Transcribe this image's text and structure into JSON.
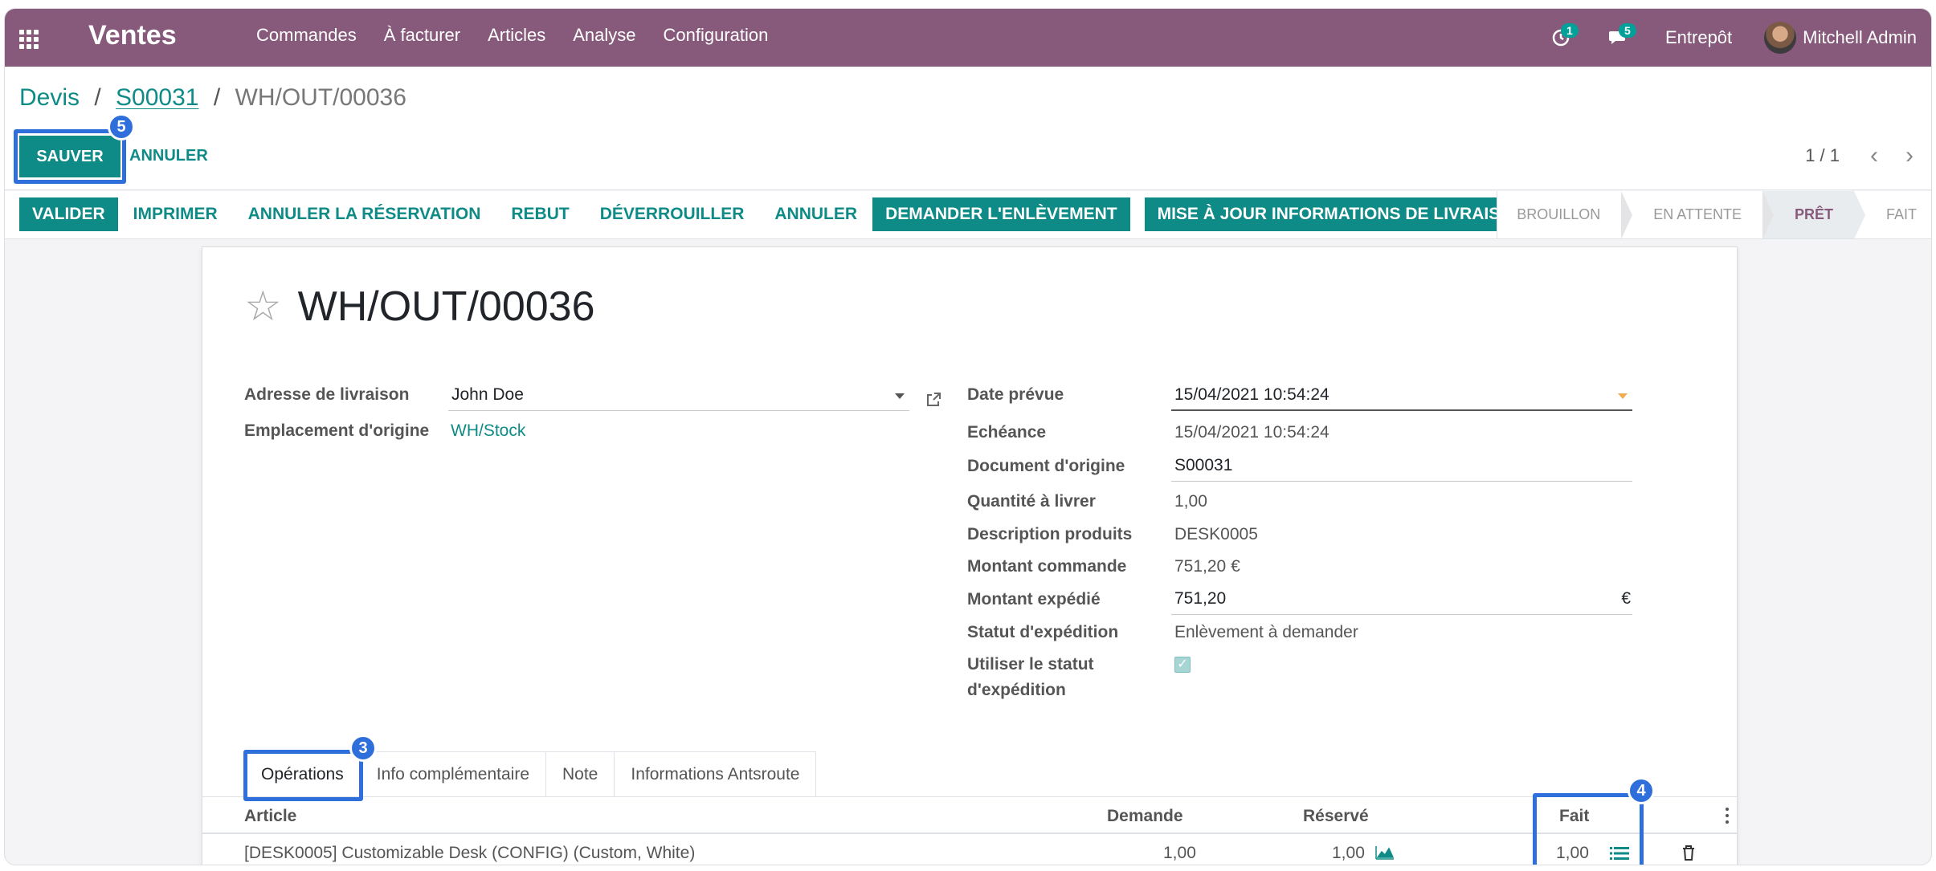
{
  "navbar": {
    "app_title": "Ventes",
    "menu": [
      "Commandes",
      "À facturer",
      "Articles",
      "Analyse",
      "Configuration"
    ],
    "activity_count": "1",
    "messages_count": "5",
    "company": "Entrepôt",
    "user": "Mitchell Admin",
    "accent": "#875a7b"
  },
  "breadcrumb": {
    "items": [
      "Devis",
      "S00031"
    ],
    "current": "WH/OUT/00036",
    "sep": "/"
  },
  "actions": {
    "save": "SAUVER",
    "discard": "ANNULER"
  },
  "pager": {
    "value": "1 / 1",
    "prev": "‹",
    "next": "›"
  },
  "statusbar": {
    "buttons": [
      "VALIDER",
      "IMPRIMER",
      "ANNULER LA RÉSERVATION",
      "REBUT",
      "DÉVERROUILLER",
      "ANNULER",
      "DEMANDER L'ENLÈVEMENT",
      "MISE À JOUR INFORMATIONS DE LIVRAISON"
    ],
    "stages": [
      "BROUILLON",
      "EN ATTENTE",
      "PRÊT",
      "FAIT"
    ],
    "active_stage": "PRÊT"
  },
  "form": {
    "record_name": "WH/OUT/00036",
    "left": {
      "delivery_address_label": "Adresse de livraison",
      "delivery_address_value": "John Doe",
      "source_location_label": "Emplacement d'origine",
      "source_location_value": "WH/Stock"
    },
    "right": {
      "scheduled_date_label": "Date prévue",
      "scheduled_date_value": "15/04/2021 10:54:24",
      "deadline_label": "Echéance",
      "deadline_value": "15/04/2021 10:54:24",
      "origin_label": "Document d'origine",
      "origin_value": "S00031",
      "qty_label": "Quantité à livrer",
      "qty_value": "1,00",
      "product_desc_label": "Description produits",
      "product_desc_value": "DESK0005",
      "order_amount_label": "Montant commande",
      "order_amount_value": "751,20 €",
      "shipped_amount_label": "Montant expédié",
      "shipped_amount_value": "751,20",
      "shipped_amount_currency": "€",
      "shipping_status_label": "Statut d'expédition",
      "shipping_status_value": "Enlèvement à demander",
      "use_status_label_1": "Utiliser le statut",
      "use_status_label_2": "d'expédition",
      "use_status_checked": true
    }
  },
  "tabs": [
    "Opérations",
    "Info complémentaire",
    "Note",
    "Informations Antsroute"
  ],
  "table": {
    "headers": {
      "article": "Article",
      "demand": "Demande",
      "reserved": "Réservé",
      "done": "Fait"
    },
    "rows": [
      {
        "article": "[DESK0005] Customizable Desk (CONFIG) (Custom, White)",
        "demand": "1,00",
        "reserved": "1,00",
        "done": "1,00"
      }
    ]
  },
  "markers": {
    "save": "5",
    "tab": "3",
    "done": "4"
  }
}
